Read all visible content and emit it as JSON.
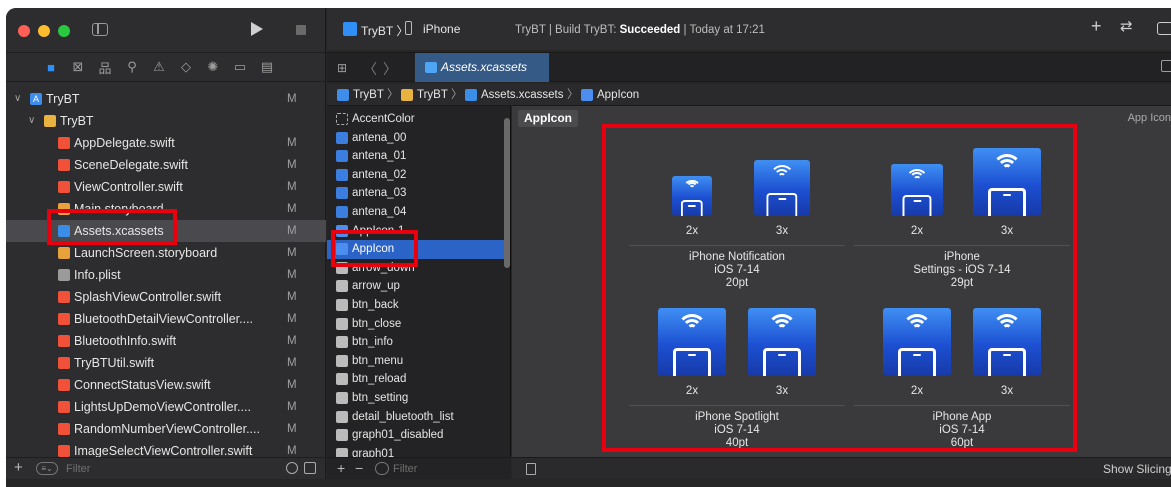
{
  "navigator": {
    "project_name": "TryBT",
    "project_status": "M",
    "folder_name": "TryBT",
    "files": [
      {
        "name": "AppDelegate.swift",
        "status": "M",
        "type": "swift"
      },
      {
        "name": "SceneDelegate.swift",
        "status": "M",
        "type": "swift"
      },
      {
        "name": "ViewController.swift",
        "status": "M",
        "type": "swift"
      },
      {
        "name": "Main.storyboard",
        "status": "M",
        "type": "storyboard"
      },
      {
        "name": "Assets.xcassets",
        "status": "M",
        "type": "xcassets",
        "selected": true
      },
      {
        "name": "LaunchScreen.storyboard",
        "status": "M",
        "type": "storyboard"
      },
      {
        "name": "Info.plist",
        "status": "M",
        "type": "plist"
      },
      {
        "name": "SplashViewController.swift",
        "status": "M",
        "type": "swift"
      },
      {
        "name": "BluetoothDetailViewController....",
        "status": "M",
        "type": "swift"
      },
      {
        "name": "BluetoothInfo.swift",
        "status": "M",
        "type": "swift"
      },
      {
        "name": "TryBTUtil.swift",
        "status": "M",
        "type": "swift"
      },
      {
        "name": "ConnectStatusView.swift",
        "status": "M",
        "type": "swift"
      },
      {
        "name": "LightsUpDemoViewController....",
        "status": "M",
        "type": "swift"
      },
      {
        "name": "RandomNumberViewController....",
        "status": "M",
        "type": "swift"
      },
      {
        "name": "ImageSelectViewController.swift",
        "status": "M",
        "type": "swift"
      }
    ],
    "filter_placeholder": "Filter"
  },
  "toolbar": {
    "scheme": "TryBT",
    "device": "iPhone",
    "activity_prefix": "TryBT | Build TryBT: ",
    "activity_status": "Succeeded",
    "activity_suffix": " | Today at 17:21"
  },
  "tab": {
    "label": "Assets.xcassets"
  },
  "jumpbar": {
    "items": [
      "TryBT",
      "TryBT",
      "Assets.xcassets",
      "AppIcon"
    ]
  },
  "asset_list": {
    "items": [
      {
        "name": "AccentColor",
        "icon": "color-set"
      },
      {
        "name": "antena_00",
        "icon": "image"
      },
      {
        "name": "antena_01",
        "icon": "image"
      },
      {
        "name": "antena_02",
        "icon": "image"
      },
      {
        "name": "antena_03",
        "icon": "image"
      },
      {
        "name": "antena_04",
        "icon": "image"
      },
      {
        "name": "AppIcon-1",
        "icon": "app-icon"
      },
      {
        "name": "AppIcon",
        "icon": "app-icon",
        "selected": true
      },
      {
        "name": "arrow_down",
        "icon": "image"
      },
      {
        "name": "arrow_up",
        "icon": "image"
      },
      {
        "name": "btn_back",
        "icon": "image"
      },
      {
        "name": "btn_close",
        "icon": "image"
      },
      {
        "name": "btn_info",
        "icon": "image"
      },
      {
        "name": "btn_menu",
        "icon": "image"
      },
      {
        "name": "btn_reload",
        "icon": "image"
      },
      {
        "name": "btn_setting",
        "icon": "image"
      },
      {
        "name": "detail_bluetooth_list",
        "icon": "image"
      },
      {
        "name": "graph01_disabled",
        "icon": "image"
      },
      {
        "name": "graph01",
        "icon": "image"
      }
    ],
    "filter_placeholder": "Filter"
  },
  "detail": {
    "set_name": "AppIcon",
    "set_kind": "App Icon",
    "slots": [
      {
        "name": "iPhone Notification",
        "os": "iOS 7-14",
        "size": "20pt",
        "scales": [
          "2x",
          "3x"
        ]
      },
      {
        "name": "iPhone",
        "os": "Settings - iOS 7-14",
        "size": "29pt",
        "scales": [
          "2x",
          "3x"
        ]
      },
      {
        "name": "iPhone Spotlight",
        "os": "iOS 7-14",
        "size": "40pt",
        "scales": [
          "2x",
          "3x"
        ]
      },
      {
        "name": "iPhone App",
        "os": "iOS 7-14",
        "size": "60pt",
        "scales": [
          "2x",
          "3x"
        ]
      }
    ],
    "show_slicing": "Show Slicing"
  },
  "colors": {
    "highlight": "#e8000f",
    "selection": "#2b63c7",
    "accent": "#2f8ff7"
  }
}
